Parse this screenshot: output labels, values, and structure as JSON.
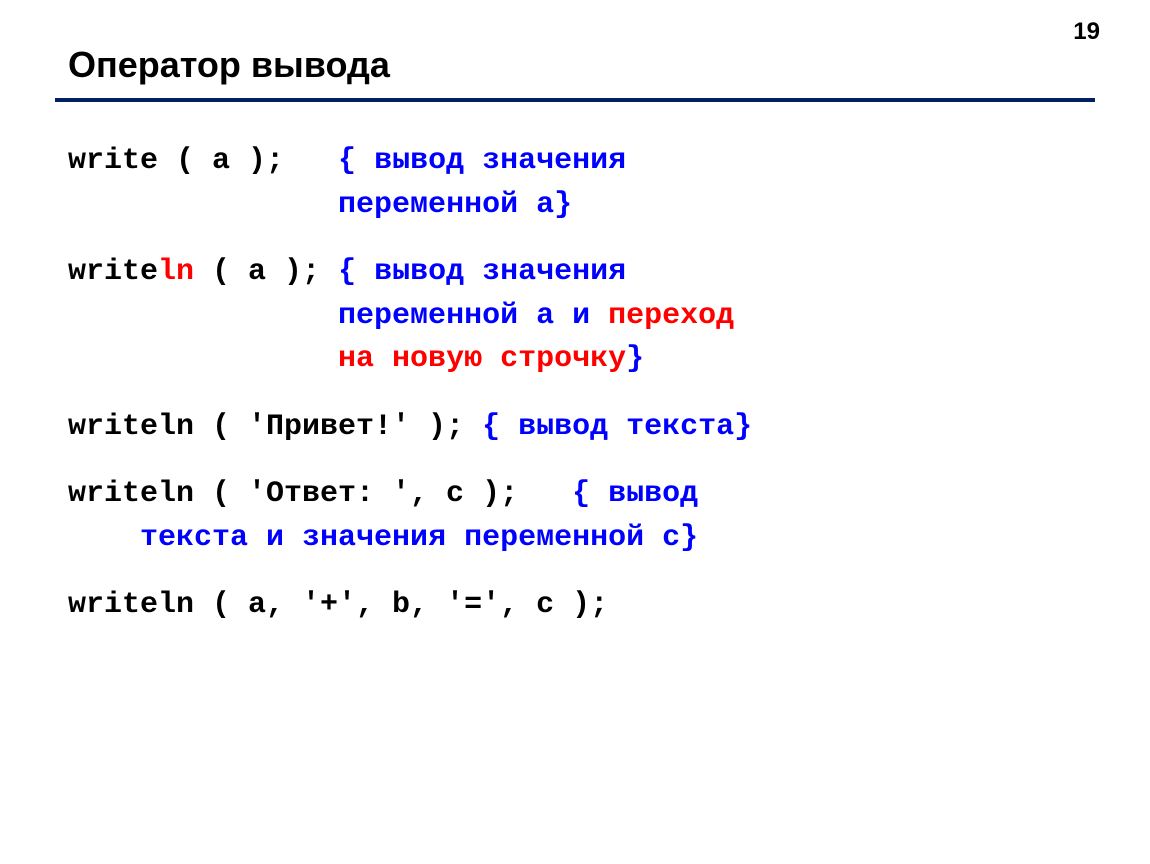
{
  "page_number": "19",
  "title": "Оператор вывода",
  "line1": {
    "code": "write ( a );   ",
    "comment_open": "{ ",
    "comment1": "вывод значения",
    "indent2": "               ",
    "comment2": "переменной a",
    "comment_close": "}"
  },
  "line2": {
    "pre": "write",
    "ln": "ln",
    "post": " ( a ); ",
    "comment_open": "{ ",
    "comment1": "вывод значения",
    "indent2": "               ",
    "comment2": "переменной a и ",
    "red1": "переход",
    "indent3": "               ",
    "red2": "на новую строчку",
    "comment_close": "}"
  },
  "line3": {
    "code": "writeln ( 'Привет!' ); ",
    "comment_open": "{ ",
    "comment": "вывод текста",
    "comment_close": "}"
  },
  "line4": {
    "code": "writeln ( 'Ответ: ', c );   ",
    "comment_open": "{ ",
    "comment1": "вывод",
    "indent2": "    ",
    "comment2": "текста и значения переменной c",
    "comment_close": "}"
  },
  "line5": {
    "code": "writeln ( a, '+', b, '=', c );"
  }
}
